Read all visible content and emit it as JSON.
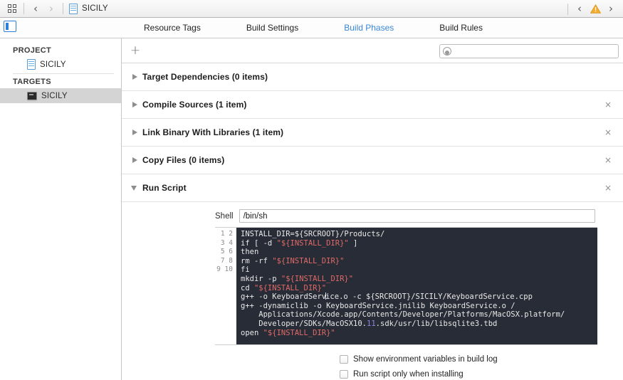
{
  "toolbar": {
    "grid_icon": "grid-icon",
    "back_arrow": "‹",
    "forward_arrow": "›",
    "document_icon": "document-icon",
    "document_title": "SICILY",
    "issue_back_arrow": "‹",
    "warning_icon": "warning-triangle-icon",
    "issue_forward_arrow": "›"
  },
  "tabs": [
    {
      "label": "Resource Tags",
      "active": false
    },
    {
      "label": "Build Settings",
      "active": false
    },
    {
      "label": "Build Phases",
      "active": true
    },
    {
      "label": "Build Rules",
      "active": false
    }
  ],
  "accent_color": "#3a87d9",
  "sidebar": {
    "project_header": "PROJECT",
    "project_item": "SICILY",
    "targets_header": "TARGETS",
    "target_item": "SICILY"
  },
  "phase_toolbar": {
    "add_label": "+",
    "search_placeholder": "",
    "search_value": ""
  },
  "phases": [
    {
      "title": "Target Dependencies (0 items)",
      "expanded": false,
      "closable": false
    },
    {
      "title": "Compile Sources (1 item)",
      "expanded": false,
      "closable": true
    },
    {
      "title": "Link Binary With Libraries (1 item)",
      "expanded": false,
      "closable": true
    },
    {
      "title": "Copy Files (0 items)",
      "expanded": false,
      "closable": true
    },
    {
      "title": "Run Script",
      "expanded": true,
      "closable": true
    }
  ],
  "close_glyph": "×",
  "run_script": {
    "shell_label": "Shell",
    "shell_value": "/bin/sh",
    "line_numbers": "1\n2\n3\n4\n5\n6\n7\n8\n9\n\n\n10",
    "script_lines": [
      "INSTALL_DIR=${SRCROOT}/Products/",
      "if [ -d \"${INSTALL_DIR}\" ]",
      "then",
      "rm -rf \"${INSTALL_DIR}\"",
      "fi",
      "mkdir -p \"${INSTALL_DIR}\"",
      "cd \"${INSTALL_DIR}\"",
      "g++ -o KeyboardService.o -c ${SRCROOT}/SICILY/KeyboardService.cpp",
      "g++ -dynamiclib -o KeyboardService.jnilib KeyboardService.o /Applications/Xcode.app/Contents/Developer/Platforms/MacOSX.platform/Developer/SDKs/MacOSX10.11.sdk/usr/lib/libsqlite3.tbd",
      "open \"${INSTALL_DIR}\""
    ],
    "checkboxes": [
      {
        "label": "Show environment variables in build log",
        "checked": false
      },
      {
        "label": "Run script only when installing",
        "checked": false
      }
    ]
  }
}
